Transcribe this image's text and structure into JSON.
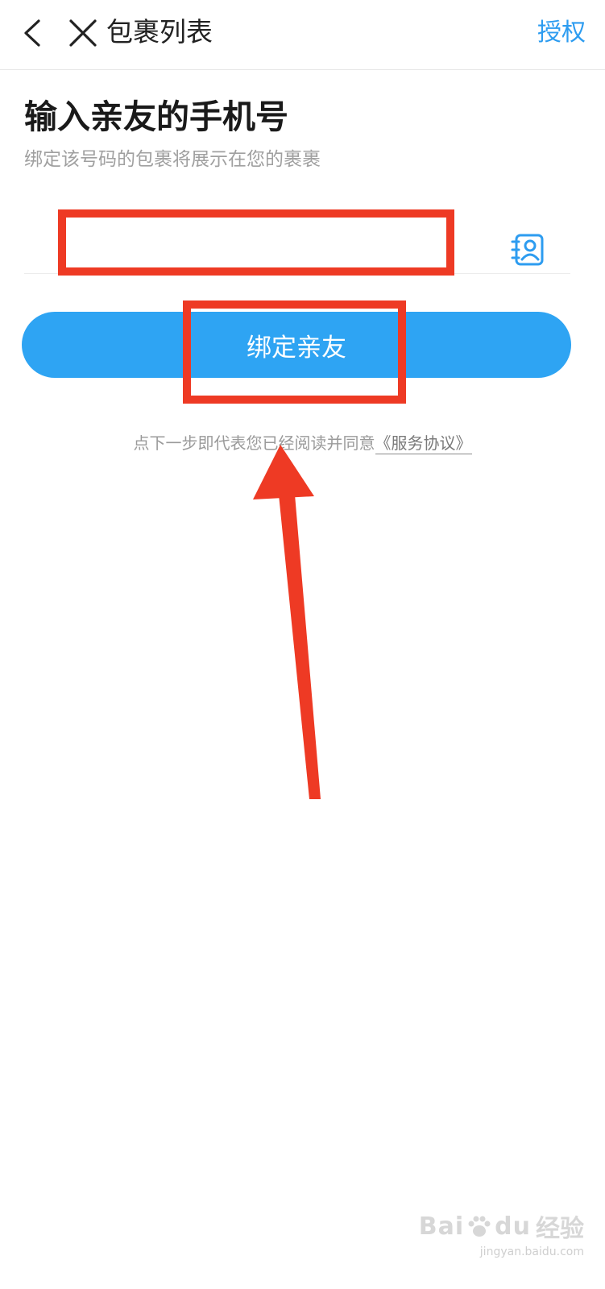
{
  "nav": {
    "title": "包裹列表",
    "action_label": "授权",
    "back_icon": "chevron-left-icon",
    "close_icon": "close-icon"
  },
  "main": {
    "heading": "输入亲友的手机号",
    "subtitle": "绑定该号码的包裹将展示在您的裹裹",
    "phone_input": {
      "value": "",
      "placeholder": ""
    },
    "contacts_icon": "contact-book-icon",
    "bind_button_label": "绑定亲友",
    "agreement_text": "点下一步即代表您已经阅读并同意",
    "agreement_link": "《服务协议》"
  },
  "watermark": {
    "logo_text_left": "Bai",
    "logo_text_right": "du",
    "logo_text_cn": "经验",
    "url": "jingyan.baidu.com"
  },
  "colors": {
    "accent": "#2ea4f3",
    "nav_action": "#2d9cf0",
    "annotation": "#ee3a24",
    "subtitle": "#a0a0a0"
  }
}
